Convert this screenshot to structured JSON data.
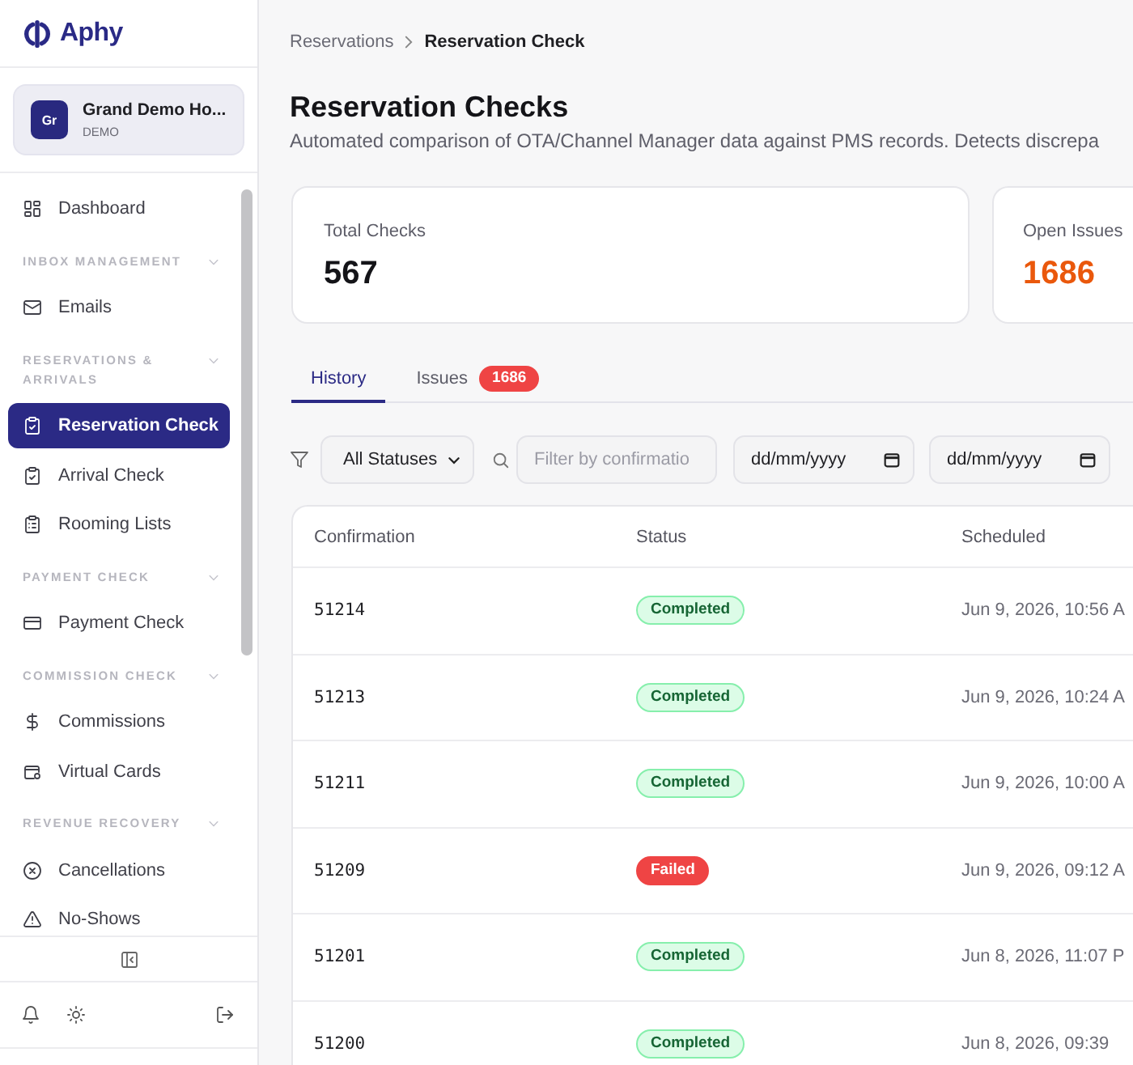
{
  "sidebar": {
    "logo": {
      "text": "Aphy"
    },
    "hotel": {
      "initials": "Gr",
      "name": "Grand Demo Ho...",
      "code": "DEMO"
    },
    "nav": {
      "items": [
        {
          "label": "Dashboard",
          "selected": false
        }
      ],
      "sections": [
        {
          "title": "INBOX MANAGEMENT",
          "expanded": true,
          "items": [
            {
              "label": "Emails",
              "selected": false
            }
          ]
        },
        {
          "title": "RESERVATIONS & ARRIVALS",
          "expanded": true,
          "items": [
            {
              "label": "Reservation Check",
              "selected": true
            },
            {
              "label": "Arrival Check",
              "selected": false
            },
            {
              "label": "Rooming Lists",
              "selected": false
            }
          ]
        },
        {
          "title": "PAYMENT CHECK",
          "expanded": true,
          "items": [
            {
              "label": "Payment Check",
              "selected": false
            }
          ]
        },
        {
          "title": "COMMISSION CHECK",
          "expanded": true,
          "items": [
            {
              "label": "Commissions",
              "selected": false
            },
            {
              "label": "Virtual Cards",
              "selected": false
            }
          ]
        },
        {
          "title": "REVENUE RECOVERY",
          "expanded": true,
          "items": [
            {
              "label": "Cancellations",
              "selected": false
            },
            {
              "label": "No-Shows",
              "selected": false
            }
          ]
        }
      ]
    }
  },
  "breadcrumb": [
    {
      "label": "Reservations"
    },
    {
      "label": "Reservation Check"
    }
  ],
  "page": {
    "title": "Reservation Checks",
    "subtitle": "Automated comparison of OTA/Channel Manager data against PMS records. Detects discrepa"
  },
  "stats": [
    {
      "label": "Total Checks",
      "value": "567",
      "kind": "neutral"
    },
    {
      "label": "Open Issues",
      "value": "1686",
      "kind": "warning"
    }
  ],
  "tabs": [
    {
      "label": "History",
      "selected": true
    },
    {
      "label": "Issues",
      "selected": false,
      "badge": "1686"
    }
  ],
  "filters": {
    "status": {
      "value": "All Statuses"
    },
    "search": {
      "placeholder": "Filter by confirmatio"
    },
    "date_from": {
      "placeholder": "dd/mm/yyyy"
    },
    "date_to": {
      "placeholder": "dd/mm/yyyy"
    }
  },
  "table": {
    "columns": [
      "Confirmation",
      "Status",
      "Scheduled"
    ],
    "rows": [
      {
        "confirmation": "51214",
        "status": {
          "label": "Completed",
          "kind": "success"
        },
        "scheduled": "Jun 9, 2026, 10:56 A"
      },
      {
        "confirmation": "51213",
        "status": {
          "label": "Completed",
          "kind": "success"
        },
        "scheduled": "Jun 9, 2026, 10:24 A"
      },
      {
        "confirmation": "51211",
        "status": {
          "label": "Completed",
          "kind": "success"
        },
        "scheduled": "Jun 9, 2026, 10:00 A"
      },
      {
        "confirmation": "51209",
        "status": {
          "label": "Failed",
          "kind": "failed"
        },
        "scheduled": "Jun 9, 2026, 09:12 A"
      },
      {
        "confirmation": "51201",
        "status": {
          "label": "Completed",
          "kind": "success"
        },
        "scheduled": "Jun 8, 2026, 11:07 P"
      },
      {
        "confirmation": "51200",
        "status": {
          "label": "Completed",
          "kind": "success"
        },
        "scheduled": "Jun 8, 2026, 09:39"
      }
    ]
  }
}
